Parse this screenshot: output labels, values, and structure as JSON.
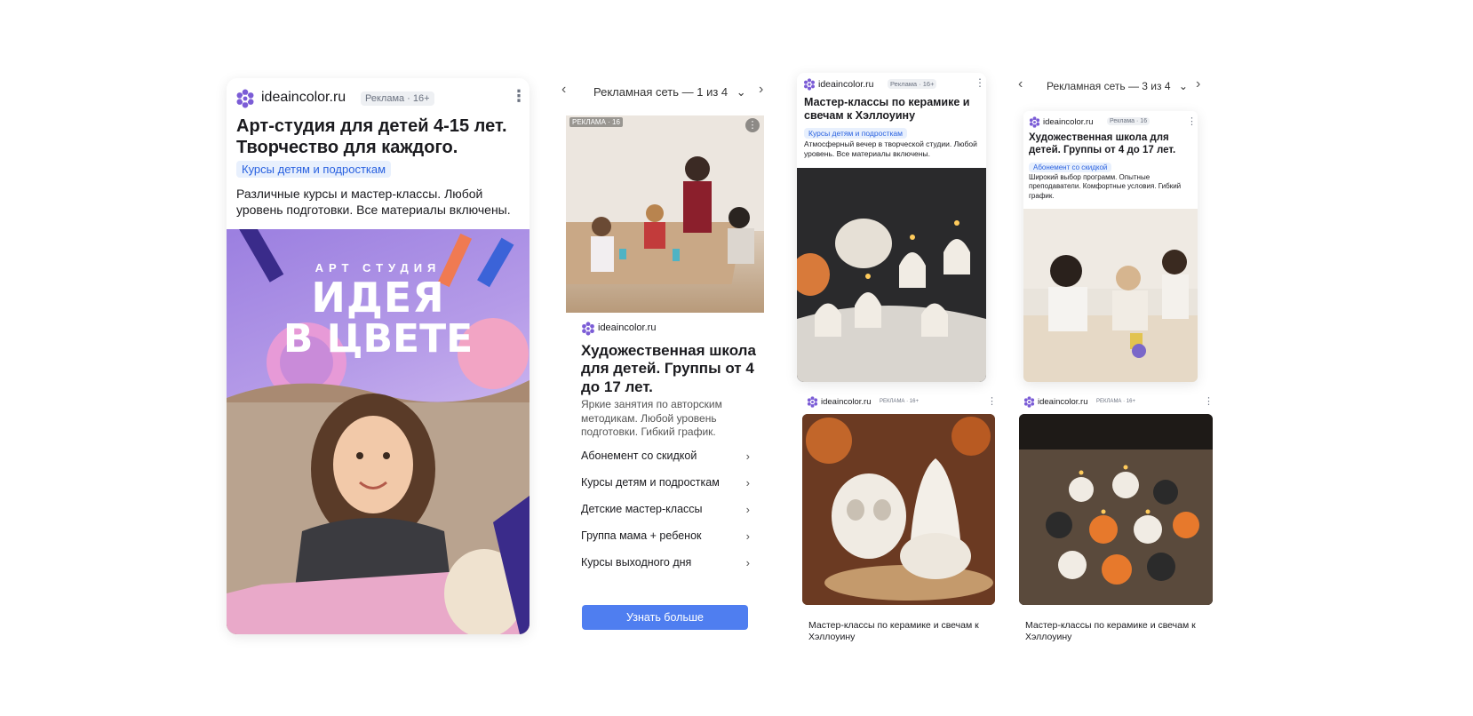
{
  "card1": {
    "domain": "ideaincolor.ru",
    "badge": "Реклама · 16+",
    "title": "Арт-студия для детей 4-15 лет. Творчество для каждого.",
    "chip": "Курсы детям и подросткам",
    "desc": "Различные курсы и мастер-классы. Любой уровень подготовки. Все материалы включены.",
    "banner_top": "АРТ СТУДИЯ",
    "banner_line1": "ИДЕЯ",
    "banner_line2": "В ЦВЕТЕ"
  },
  "card2": {
    "nav_text": "Рекламная сеть — 1 из 4",
    "image_badge": "РЕКЛАМА · 16",
    "domain": "ideaincolor.ru",
    "title": "Художественная школа для детей. Группы от 4 до 17 лет.",
    "desc": "Яркие занятия по авторским методикам. Любой уровень подготовки. Гибкий график.",
    "links": [
      "Абонемент со скидкой",
      "Курсы детям и подросткам",
      "Детские мастер-классы",
      "Группа мама + ребенок",
      "Курсы выходного дня"
    ],
    "cta": "Узнать больше"
  },
  "card3": {
    "domain": "ideaincolor.ru",
    "badge": "Реклама · 16+",
    "title": "Мастер-классы по керамике и свечам к Хэллоуину",
    "chip": "Курсы детям и подросткам",
    "desc": "Атмосферный вечер в творческой студии. Любой уровень. Все материалы включены."
  },
  "card4": {
    "nav_text": "Рекламная сеть — 3 из 4",
    "domain": "ideaincolor.ru",
    "badge": "Реклама · 16",
    "title": "Художественная школа для детей. Группы от 4 до 17 лет.",
    "chip": "Абонемент со скидкой",
    "desc": "Широкий выбор программ. Опытные преподаватели. Комфортные условия. Гибкий график."
  },
  "card5": {
    "domain": "ideaincolor.ru",
    "badge": "РЕКЛАМА · 16+",
    "caption": "Мастер-классы по керамике и свечам к Хэллоуину"
  },
  "card6": {
    "domain": "ideaincolor.ru",
    "badge": "РЕКЛАМА · 16+",
    "caption": "Мастер-классы по керамике и свечам к Хэллоуину"
  },
  "icons": {
    "logo": "flower-logo-icon",
    "menu": "more-vertical-icon",
    "prev": "chevron-left-icon",
    "next": "chevron-right-icon",
    "dropdown": "chevron-down-icon"
  },
  "colors": {
    "accent": "#4f7ef0",
    "logo": "#7b5cd6",
    "chip_bg": "#e8f0fd",
    "chip_text": "#2a62e0"
  }
}
